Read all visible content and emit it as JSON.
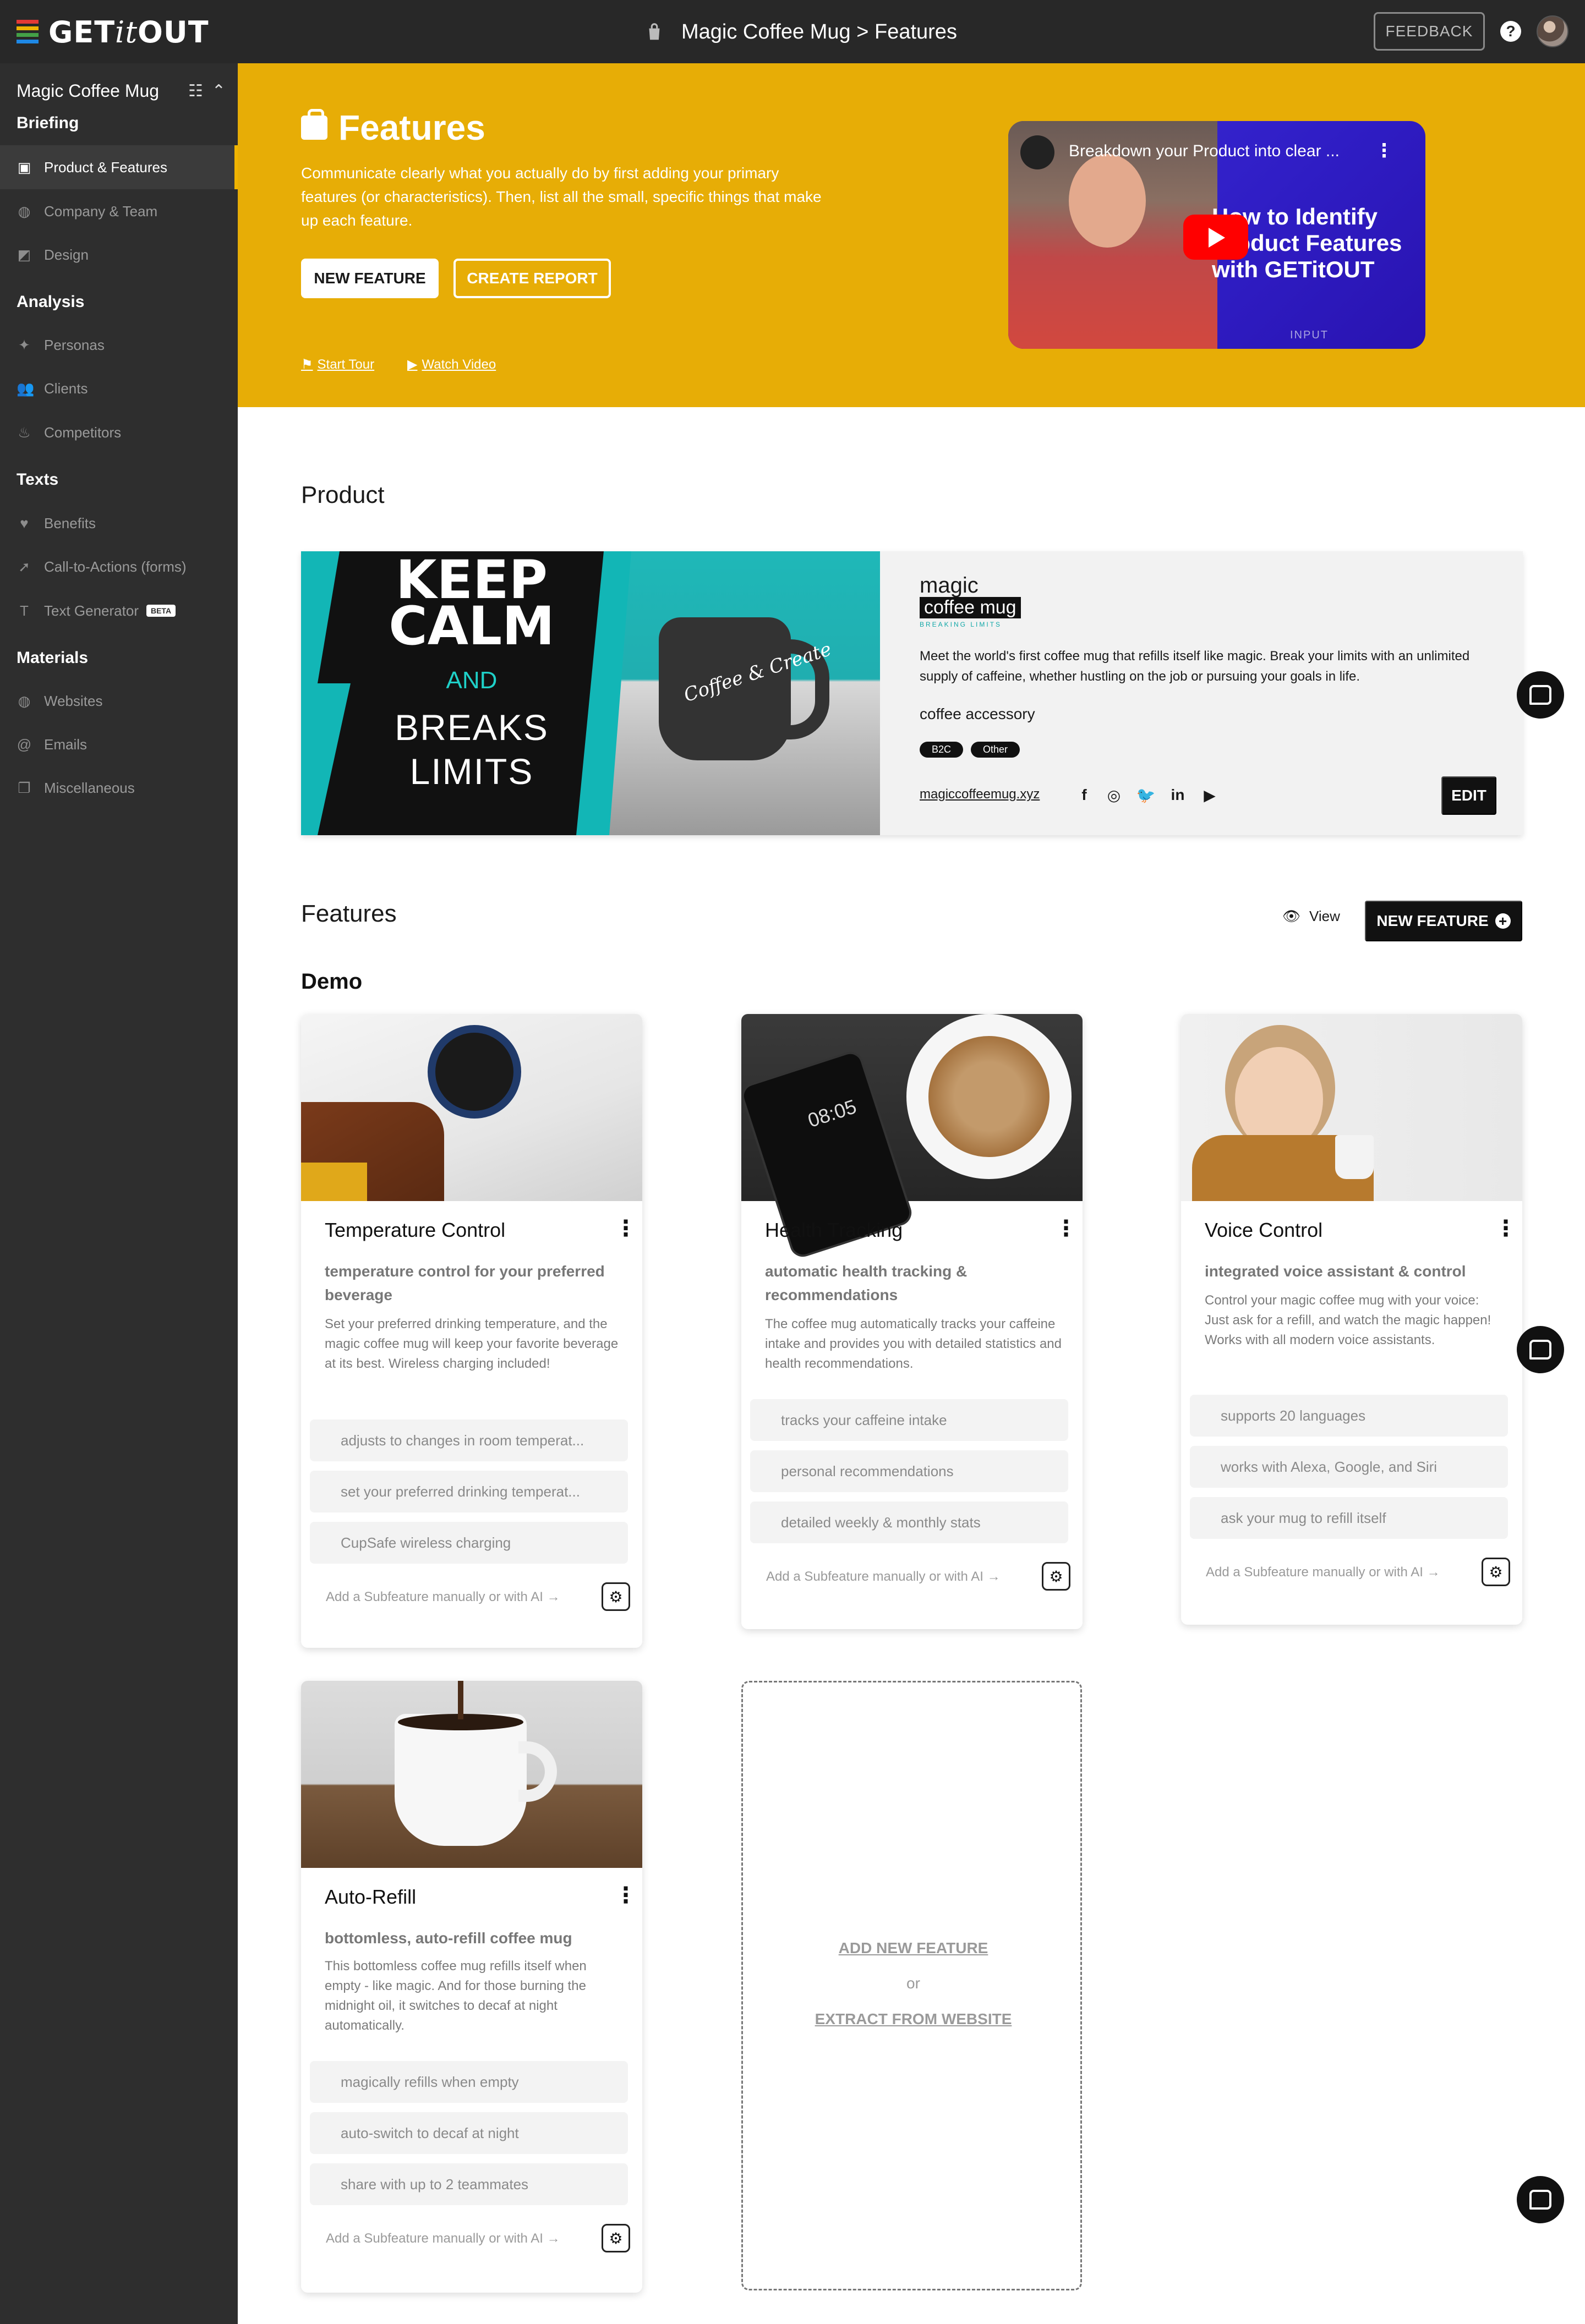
{
  "app": {
    "logo_text_1": "GET",
    "logo_text_2": "it",
    "logo_text_3": "OUT",
    "breadcrumb": "Magic Coffee Mug > Features",
    "feedback_label": "FEEDBACK",
    "help_label": "?"
  },
  "sidebar": {
    "project_name": "Magic Coffee Mug",
    "sections": [
      {
        "title": "Briefing",
        "items": [
          {
            "label": "Product & Features",
            "icon": "bag-icon",
            "active": true
          },
          {
            "label": "Company & Team",
            "icon": "globe-icon"
          },
          {
            "label": "Design",
            "icon": "design-icon"
          }
        ]
      },
      {
        "title": "Analysis",
        "items": [
          {
            "label": "Personas",
            "icon": "person-icon"
          },
          {
            "label": "Clients",
            "icon": "group-icon"
          },
          {
            "label": "Competitors",
            "icon": "fire-icon"
          }
        ]
      },
      {
        "title": "Texts",
        "items": [
          {
            "label": "Benefits",
            "icon": "heart-icon"
          },
          {
            "label": "Call-to-Actions (forms)",
            "icon": "cursor-icon"
          },
          {
            "label": "Text Generator",
            "icon": "text-gen-icon",
            "badge": "BETA"
          }
        ]
      },
      {
        "title": "Materials",
        "items": [
          {
            "label": "Websites",
            "icon": "globe-icon"
          },
          {
            "label": "Emails",
            "icon": "at-icon"
          },
          {
            "label": "Miscellaneous",
            "icon": "copy-icon"
          }
        ]
      }
    ]
  },
  "hero": {
    "title": "Features",
    "description": "Communicate clearly what you actually do by first adding your primary features (or characteristics). Then, list all the small, specific things that make up each feature.",
    "btn_new_feature": "NEW FEATURE",
    "btn_create_report": "CREATE REPORT",
    "link_start_tour": "Start Tour",
    "link_watch_video": "Watch Video",
    "video_title": "Breakdown your Product into clear ...",
    "video_big_text_1": "How to Identify",
    "video_big_text_2": "Product Features",
    "video_big_text_3": "with GETitOUT",
    "video_corner": "INPUT"
  },
  "product": {
    "section_title": "Product",
    "image_text": {
      "keep": "KEEP",
      "calm": "CALM",
      "and": "AND",
      "breaks": "BREAKS",
      "limits": "LIMITS",
      "mug": "Coffee & Create"
    },
    "brand_line1": "magic",
    "brand_line2": "coffee mug",
    "brand_line3": "BREAKING LIMITS",
    "description": "Meet the world's first coffee mug that refills itself like magic. Break your limits with an unlimited supply of caffeine, whether hustling on the job or pursuing your goals in life.",
    "category": "coffee accessory",
    "tags": [
      "B2C",
      "Other"
    ],
    "website": "magiccoffeemug.xyz",
    "socials": [
      "facebook-icon",
      "instagram-icon",
      "twitter-icon",
      "linkedin-icon",
      "youtube-icon"
    ],
    "edit_label": "EDIT"
  },
  "features": {
    "section_title": "Features",
    "view_label": "View",
    "new_feature_label": "NEW FEATURE",
    "group_title": "Demo",
    "add_subfeature_label": "Add a Subfeature manually or with AI →",
    "cards": [
      {
        "title": "Temperature Control",
        "subtitle": "temperature control for your preferred beverage",
        "description": "Set your preferred drinking temperature, and the magic coffee mug will keep your favorite beverage at its best. Wireless charging included!",
        "subfeatures": [
          "adjusts to changes in room temperat...",
          "set your preferred drinking temperat...",
          "CupSafe wireless charging"
        ]
      },
      {
        "title": "Health Tracking",
        "subtitle": "automatic health tracking & recommendations",
        "description": "The coffee mug automatically tracks your caffeine intake and provides you with detailed statistics and health recommendations.",
        "subfeatures": [
          "tracks your caffeine intake",
          "personal recommendations",
          "detailed weekly & monthly stats"
        ]
      },
      {
        "title": "Voice Control",
        "subtitle": "integrated voice assistant & control",
        "description": "Control your magic coffee mug with your voice: Just ask for a refill, and watch the magic happen! Works with all modern voice assistants.",
        "subfeatures": [
          "supports 20 languages",
          "works with Alexa, Google, and Siri",
          "ask your mug to refill itself"
        ]
      },
      {
        "title": "Auto-Refill",
        "subtitle": "bottomless, auto-refill coffee mug",
        "description": "This bottomless coffee mug refills itself when empty - like magic. And for those burning the midnight oil, it switches to decaf at night automatically.",
        "subfeatures": [
          "magically refills when empty",
          "auto-switch to decaf at night",
          "share with up to 2 teammates"
        ]
      }
    ],
    "add_card": {
      "add_new": "ADD NEW FEATURE",
      "or": "or",
      "extract": "EXTRACT FROM WEBSITE"
    }
  },
  "colors": {
    "accent": "#e7ad06",
    "sidebar": "#2e2e2e",
    "topbar": "#282828"
  }
}
